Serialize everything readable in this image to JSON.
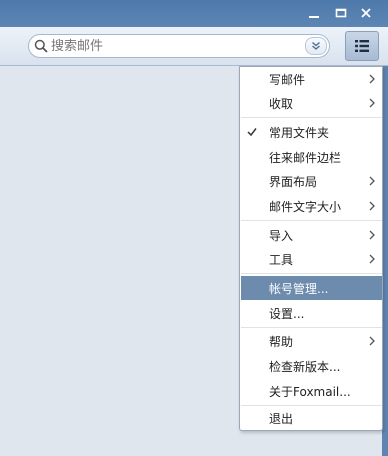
{
  "search": {
    "placeholder": "搜索邮件"
  },
  "menu": {
    "items": [
      {
        "label": "写邮件",
        "submenu": true
      },
      {
        "label": "收取",
        "submenu": true
      },
      {
        "label": "常用文件夹",
        "checked": true
      },
      {
        "label": "往来邮件边栏"
      },
      {
        "label": "界面布局",
        "submenu": true
      },
      {
        "label": "邮件文字大小",
        "submenu": true
      },
      {
        "label": "导入",
        "submenu": true
      },
      {
        "label": "工具",
        "submenu": true
      },
      {
        "label": "帐号管理...",
        "highlighted": true
      },
      {
        "label": "设置..."
      },
      {
        "label": "帮助",
        "submenu": true
      },
      {
        "label": "检查新版本..."
      },
      {
        "label": "关于Foxmail..."
      },
      {
        "label": "退出"
      }
    ]
  },
  "colors": {
    "titlebar": "#5680b0",
    "menu_highlight": "#6c8bad",
    "background": "#dfe6ee"
  }
}
